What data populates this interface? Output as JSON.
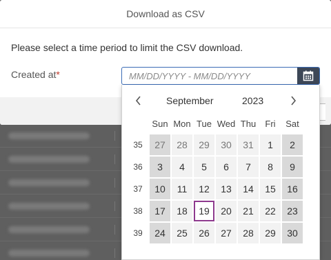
{
  "dialog": {
    "title": "Download as CSV",
    "description": "Please select a time period to limit the CSV download.",
    "field_label": "Created at",
    "required_mark": "*",
    "date_placeholder": "MM/DD/YYYY - MM/DD/YYYY"
  },
  "calendar": {
    "month": "September",
    "year": "2023",
    "prev_icon": "chevron-left-icon",
    "next_icon": "chevron-right-icon",
    "weekdays": [
      "Sun",
      "Mon",
      "Tue",
      "Wed",
      "Thu",
      "Fri",
      "Sat"
    ],
    "weeks": [
      {
        "number": "35",
        "days": [
          "27",
          "28",
          "29",
          "30",
          "31",
          "1",
          "2"
        ]
      },
      {
        "number": "36",
        "days": [
          "3",
          "4",
          "5",
          "6",
          "7",
          "8",
          "9"
        ]
      },
      {
        "number": "37",
        "days": [
          "10",
          "11",
          "12",
          "13",
          "14",
          "15",
          "16"
        ]
      },
      {
        "number": "38",
        "days": [
          "17",
          "18",
          "19",
          "20",
          "21",
          "22",
          "23"
        ]
      },
      {
        "number": "39",
        "days": [
          "24",
          "25",
          "26",
          "27",
          "28",
          "29",
          "30"
        ]
      }
    ],
    "today": "19",
    "colors": {
      "today_border": "#8e3a8e",
      "weekend_bg": "#d9d9d9",
      "weekday_bg": "#f2f2f2",
      "input_border": "#3a6bb5",
      "calendar_button_bg": "#3d4757",
      "required": "#c0392b"
    }
  }
}
